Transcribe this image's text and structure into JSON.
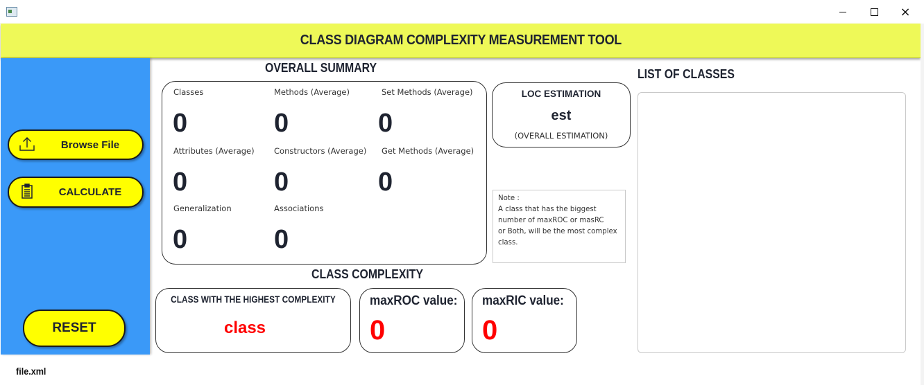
{
  "window": {
    "buttons": {
      "minimize": "minimize",
      "maximize": "maximize",
      "close": "×"
    }
  },
  "header": {
    "title": "CLASS DIAGRAM COMPLEXITY MEASUREMENT TOOL"
  },
  "sidebar": {
    "browse_label": "Browse File",
    "calculate_label": "CALCULATE",
    "reset_label": "RESET",
    "browse_icon": "upload-icon",
    "calculate_icon": "clipboard-icon"
  },
  "overall": {
    "title": "OVERALL SUMMARY",
    "stats": [
      {
        "label": "Classes",
        "value": "0"
      },
      {
        "label": "Methods (Average)",
        "value": "0"
      },
      {
        "label": "Set Methods (Average)",
        "value": "0"
      },
      {
        "label": "Attributes (Average)",
        "value": "0"
      },
      {
        "label": "Constructors (Average)",
        "value": "0"
      },
      {
        "label": "Get Methods (Average)",
        "value": "0"
      },
      {
        "label": "Generalization",
        "value": "0"
      },
      {
        "label": "Associations",
        "value": "0"
      }
    ]
  },
  "loc": {
    "title": "LOC ESTIMATION",
    "value": "est",
    "subtitle": "(OVERALL ESTIMATION)"
  },
  "note": {
    "text": "Note :\nA class that has the biggest\nnumber of maxROC or masRC\nor Both, will be the most complex\nclass."
  },
  "complexity": {
    "title": "CLASS COMPLEXITY",
    "highest_label": "CLASS WITH THE HIGHEST COMPLEXITY",
    "highest_value": "class",
    "maxroc_label": "maxROC value:",
    "maxroc_value": "0",
    "maxric_label": "maxRIC value:",
    "maxric_value": "0"
  },
  "list": {
    "title": "LIST OF CLASSES",
    "items": []
  },
  "footer": {
    "file": "file.xml"
  },
  "colors": {
    "header_bg": "#eef958",
    "sidebar_bg": "#3a99f8",
    "button_bg": "#ffff00",
    "accent_red": "#ff0000",
    "text_dark": "#1e2330"
  }
}
